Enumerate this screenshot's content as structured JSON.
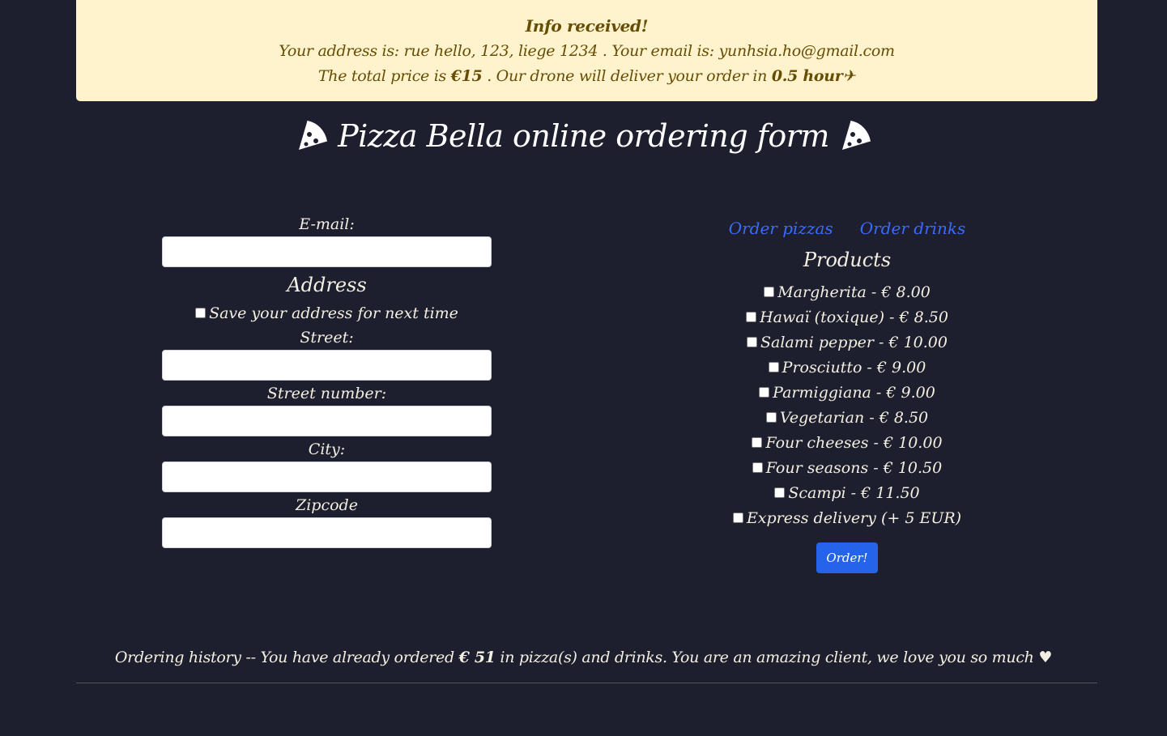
{
  "alert": {
    "heading": "Info received!",
    "address_prefix": "Your address is: ",
    "address": "rue hello, 123, liege 1234",
    "email_prefix": " . Your email is: ",
    "email": "yunhsia.ho@gmail.com",
    "price_prefix": "The total price is ",
    "price": "€15",
    "delivery_prefix": " . Our drone will deliver your order in ",
    "delivery_time": "0.5 hour",
    "plane_icon": "✈"
  },
  "page_title": "Pizza Bella online ordering form",
  "form": {
    "email_label": "E-mail:",
    "address_title": "Address",
    "save_address_label": "Save your address for next time",
    "street_label": "Street:",
    "street_number_label": "Street number:",
    "city_label": "City:",
    "zipcode_label": "Zipcode"
  },
  "order": {
    "links": [
      "Order pizzas",
      "Order drinks"
    ],
    "products_title": "Products",
    "products": [
      "Margherita - € 8.00",
      "Hawaï (toxique) - € 8.50",
      "Salami pepper - € 10.00",
      "Prosciutto - € 9.00",
      "Parmiggiana - € 9.00",
      "Vegetarian - € 8.50",
      "Four cheeses - € 10.00",
      "Four seasons - € 10.50",
      "Scampi - € 11.50"
    ],
    "express_label": "Express delivery (+ 5 EUR)",
    "button_label": "Order!"
  },
  "history": {
    "prefix": "Ordering history -- You have already ordered ",
    "amount": "€ 51",
    "suffix": " in pizza(s) and drinks. You are an amazing client, we love you so much ♥"
  }
}
